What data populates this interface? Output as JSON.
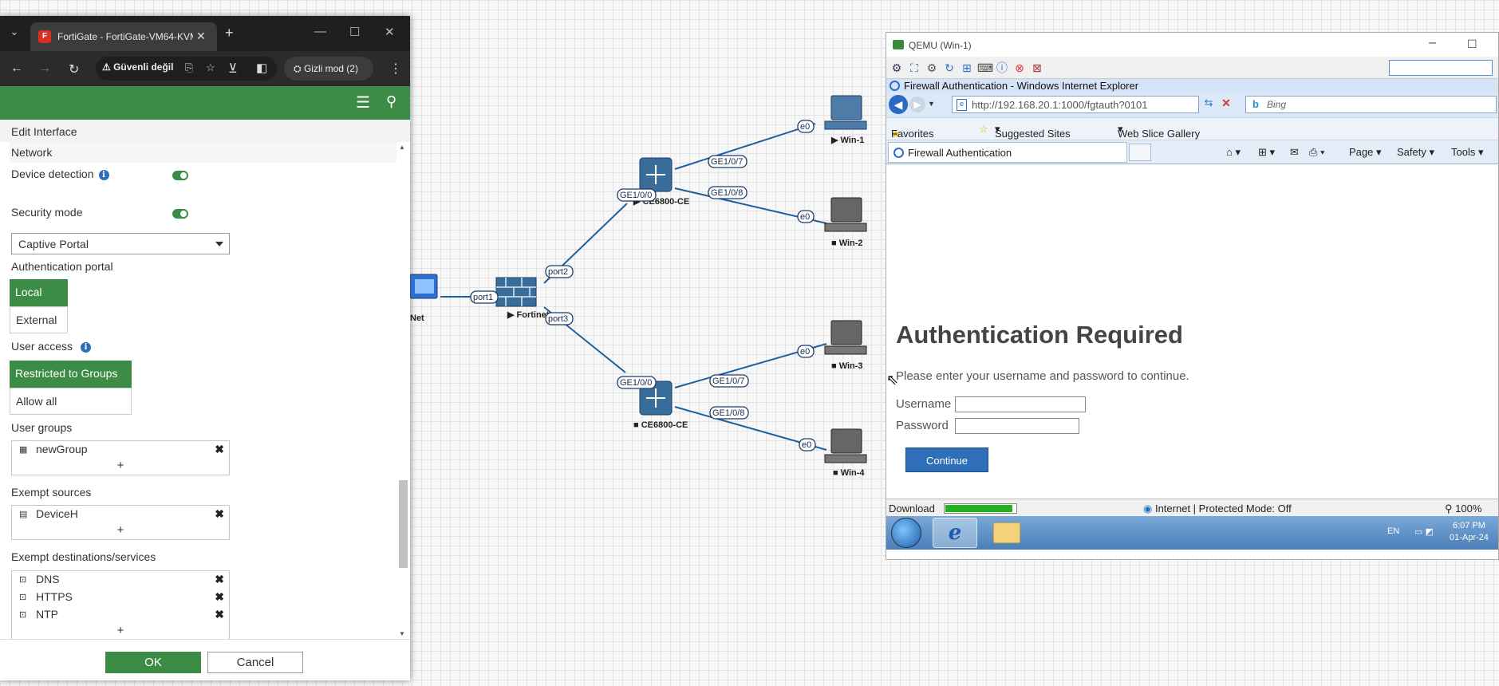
{
  "browser": {
    "tab_title": "FortiGate - FortiGate-VM64-KVM",
    "security_chip": "Güvenli değil",
    "incognito_label": "Gizli mod (2)"
  },
  "fortigate": {
    "header_color": "#3d8c46",
    "panel_title": "Edit Interface",
    "section": "Network",
    "device_detection_label": "Device detection",
    "security_mode_label": "Security mode",
    "security_mode_value": "Captive Portal",
    "auth_portal_label": "Authentication portal",
    "auth_portal_options": [
      "Local",
      "External"
    ],
    "auth_portal_selected": "Local",
    "user_access_label": "User access",
    "user_access_options": [
      "Restricted to Groups",
      "Allow all"
    ],
    "user_access_selected": "Restricted to Groups",
    "user_groups_label": "User groups",
    "user_groups": [
      "newGroup"
    ],
    "exempt_sources_label": "Exempt sources",
    "exempt_sources": [
      "DeviceH"
    ],
    "exempt_dest_label": "Exempt destinations/services",
    "exempt_destinations": [
      "DNS",
      "HTTPS",
      "NTP"
    ],
    "add_symbol": "+",
    "remove_symbol": "✖",
    "ok_label": "OK",
    "cancel_label": "Cancel"
  },
  "topology": {
    "nodes": {
      "net": "Net",
      "fortinet": "Fortinet",
      "ce1": "CE6800-CE",
      "ce2": "CE6800-CE",
      "win1": "Win-1",
      "win2": "Win-2",
      "win3": "Win-3",
      "win4": "Win-4"
    },
    "ports": {
      "port1": "port1",
      "port2": "port2",
      "port3": "port3",
      "ce1_up": "GE1/0/0",
      "ce1_a": "GE1/0/7",
      "ce1_b": "GE1/0/8",
      "ce2_up": "GE1/0/0",
      "ce2_a": "GE1/0/7",
      "ce2_b": "GE1/0/8",
      "e0": "e0"
    },
    "link_color": "#1f5f9e"
  },
  "qemu": {
    "window_title": "QEMU (Win-1)",
    "ie_title": "Firewall Authentication - Windows Internet Explorer",
    "url": "http://192.168.20.1:1000/fgtauth?0101",
    "search_placeholder": "Bing",
    "favorites_label": "Favorites",
    "suggested_sites": "Suggested Sites",
    "web_slice_gallery": "Web Slice Gallery",
    "tab_title": "Firewall Authentication",
    "page_menu": "Page",
    "safety_menu": "Safety",
    "tools_menu": "Tools",
    "heading": "Authentication Required",
    "message": "Please enter your username and password to continue.",
    "username_label": "Username",
    "password_label": "Password",
    "continue_label": "Continue",
    "status_download": "Download",
    "download_progress": 0.95,
    "status_zone": "Internet | Protected Mode: Off",
    "zoom": "100%",
    "lang": "EN",
    "clock_time": "6:07 PM",
    "clock_date": "01-Apr-24"
  }
}
